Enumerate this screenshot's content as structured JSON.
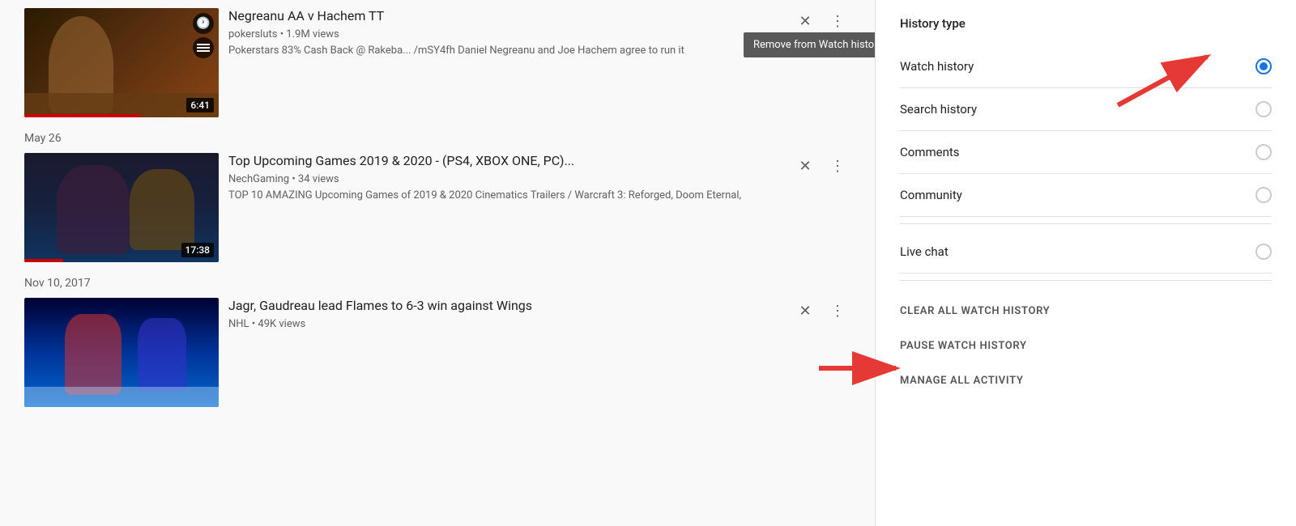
{
  "left": {
    "videos": [
      {
        "id": "poker",
        "title": "Negreanu AA v Hachem TT",
        "channel": "pokersluts • 1.9M views",
        "description": "Pokerstars 83% Cash Back @ Rakeba... /mSY4fh Daniel Negreanu and Joe Hachem agree to run it",
        "duration": "6:41",
        "thumbType": "poker",
        "tooltip": "Remove from Watch history",
        "showTooltip": true,
        "progressWidth": "60%"
      },
      {
        "id": "games",
        "title": "Top Upcoming Games 2019 & 2020 - (PS4, XBOX ONE, PC)...",
        "channel": "NechGaming • 34 views",
        "description": "TOP 10 AMAZING Upcoming Games of 2019 & 2020 Cinematics Trailers / Warcraft 3: Reforged, Doom Eternal,",
        "duration": "17:38",
        "thumbType": "games",
        "showTooltip": false,
        "progressWidth": "20%"
      },
      {
        "id": "hockey",
        "title": "Jagr, Gaudreau lead Flames to 6-3 win against Wings",
        "channel": "NHL • 49K views",
        "description": "",
        "duration": "",
        "thumbType": "hockey",
        "showTooltip": false,
        "progressWidth": "0%"
      }
    ],
    "dateLabels": [
      {
        "id": "may26",
        "text": "May 26",
        "afterIndex": 0
      },
      {
        "id": "nov10",
        "text": "Nov 10, 2017",
        "afterIndex": 1
      }
    ]
  },
  "right": {
    "title": "History type",
    "options": [
      {
        "id": "watch",
        "label": "Watch history",
        "selected": true
      },
      {
        "id": "search",
        "label": "Search history",
        "selected": false
      },
      {
        "id": "comments",
        "label": "Comments",
        "selected": false
      },
      {
        "id": "community",
        "label": "Community",
        "selected": false
      },
      {
        "id": "livechat",
        "label": "Live chat",
        "selected": false
      }
    ],
    "actions": [
      {
        "id": "clear",
        "label": "CLEAR ALL WATCH HISTORY"
      },
      {
        "id": "pause",
        "label": "PAUSE WATCH HISTORY"
      },
      {
        "id": "manage",
        "label": "MANAGE ALL ACTIVITY"
      }
    ]
  },
  "icons": {
    "close": "✕",
    "more": "⋮",
    "clock": "🕐",
    "lines": "≡"
  }
}
